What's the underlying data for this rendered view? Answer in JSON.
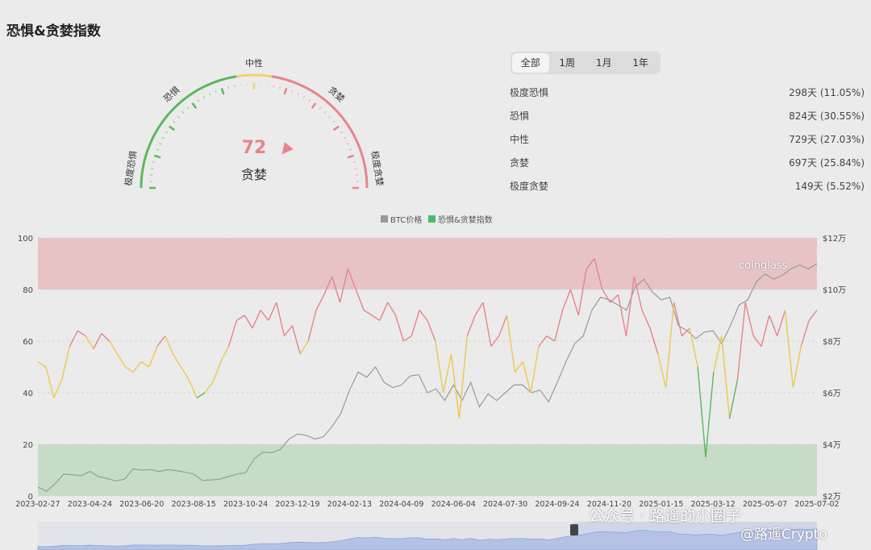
{
  "title": "恐惧&贪婪指数",
  "gauge": {
    "value": 72,
    "value_text": "72",
    "status": "贪婪",
    "labels": [
      "极度恐惧",
      "恐惧",
      "中性",
      "贪婪",
      "极度贪婪"
    ],
    "colors": {
      "fear": "#5cb85c",
      "neutral": "#f0d36a",
      "greed": "#e7848a",
      "pointer": "#e7848a"
    }
  },
  "tabs": [
    "全部",
    "1周",
    "1月",
    "1年"
  ],
  "active_tab": "全部",
  "stats": [
    {
      "label": "极度恐惧",
      "value": "298天 (11.05%)"
    },
    {
      "label": "恐惧",
      "value": "824天 (30.55%)"
    },
    {
      "label": "中性",
      "value": "729天 (27.03%)"
    },
    {
      "label": "贪婪",
      "value": "697天 (25.84%)"
    },
    {
      "label": "极度贪婪",
      "value": "149天 (5.52%)"
    }
  ],
  "chart_data": {
    "type": "line",
    "legend": [
      "BTC价格",
      "恐惧&贪婪指数"
    ],
    "legend_placement": "top-center",
    "x_labels": [
      "2023-02-27",
      "2023-04-24",
      "2023-06-20",
      "2023-08-15",
      "2023-10-24",
      "2023-12-19",
      "2024-02-13",
      "2024-04-09",
      "2024-06-04",
      "2024-07-30",
      "2024-09-24",
      "2024-11-20",
      "2025-01-15",
      "2025-03-12",
      "2025-05-07",
      "2025-07-02"
    ],
    "y_left_ticks": [
      "0",
      "20",
      "40",
      "60",
      "80",
      "100"
    ],
    "y_left_range": [
      0,
      100
    ],
    "y_right_ticks": [
      "$2万",
      "$4万",
      "$6万",
      "$8万",
      "$10万",
      "$12万"
    ],
    "y_right_range": [
      20000,
      120000
    ],
    "zones": [
      {
        "from": 80,
        "to": 100,
        "color": "#e7c3c6"
      },
      {
        "from": 0,
        "to": 20,
        "color": "#c7dcc6"
      }
    ],
    "series": [
      {
        "name": "恐惧&贪婪指数",
        "axis": "left",
        "values": [
          52,
          50,
          38,
          45,
          58,
          64,
          62,
          57,
          63,
          60,
          55,
          50,
          48,
          52,
          50,
          58,
          62,
          55,
          50,
          45,
          38,
          40,
          44,
          52,
          58,
          68,
          70,
          65,
          72,
          68,
          75,
          62,
          66,
          55,
          60,
          72,
          78,
          85,
          75,
          88,
          80,
          72,
          70,
          68,
          75,
          70,
          60,
          62,
          72,
          68,
          60,
          40,
          55,
          30,
          62,
          70,
          75,
          58,
          62,
          70,
          48,
          52,
          40,
          58,
          62,
          60,
          72,
          80,
          70,
          88,
          92,
          80,
          75,
          78,
          62,
          85,
          72,
          65,
          55,
          42,
          75,
          62,
          65,
          50,
          15,
          48,
          62,
          30,
          45,
          75,
          62,
          58,
          70,
          62,
          72,
          42,
          58,
          68,
          72
        ]
      },
      {
        "name": "BTC价格",
        "axis": "right",
        "values": [
          23500,
          21800,
          24800,
          28500,
          28200,
          27800,
          29500,
          27500,
          26800,
          25800,
          26500,
          30500,
          30000,
          30200,
          29500,
          30200,
          29800,
          29200,
          28500,
          26000,
          26200,
          26500,
          27500,
          28500,
          29000,
          34500,
          37000,
          36800,
          38000,
          42000,
          44000,
          43500,
          42000,
          43000,
          47000,
          52000,
          61000,
          68000,
          66000,
          70000,
          64000,
          62000,
          63000,
          66500,
          67000,
          60000,
          61500,
          57000,
          63000,
          57000,
          64000,
          54500,
          59500,
          57000,
          60000,
          63000,
          63000,
          60000,
          61000,
          56500,
          64000,
          72000,
          79000,
          82000,
          92000,
          97000,
          96000,
          94000,
          92000,
          101000,
          104000,
          99000,
          96000,
          97000,
          86000,
          84000,
          81000,
          83500,
          84000,
          79000,
          86000,
          94000,
          96000,
          103000,
          106000,
          104000,
          105500,
          108000,
          109500,
          108000,
          110000
        ]
      }
    ]
  },
  "watermarks": {
    "brand": "coinglass",
    "wechat": "公众号 · 路遥的小圈子",
    "handle": "@路遥Crypto"
  }
}
